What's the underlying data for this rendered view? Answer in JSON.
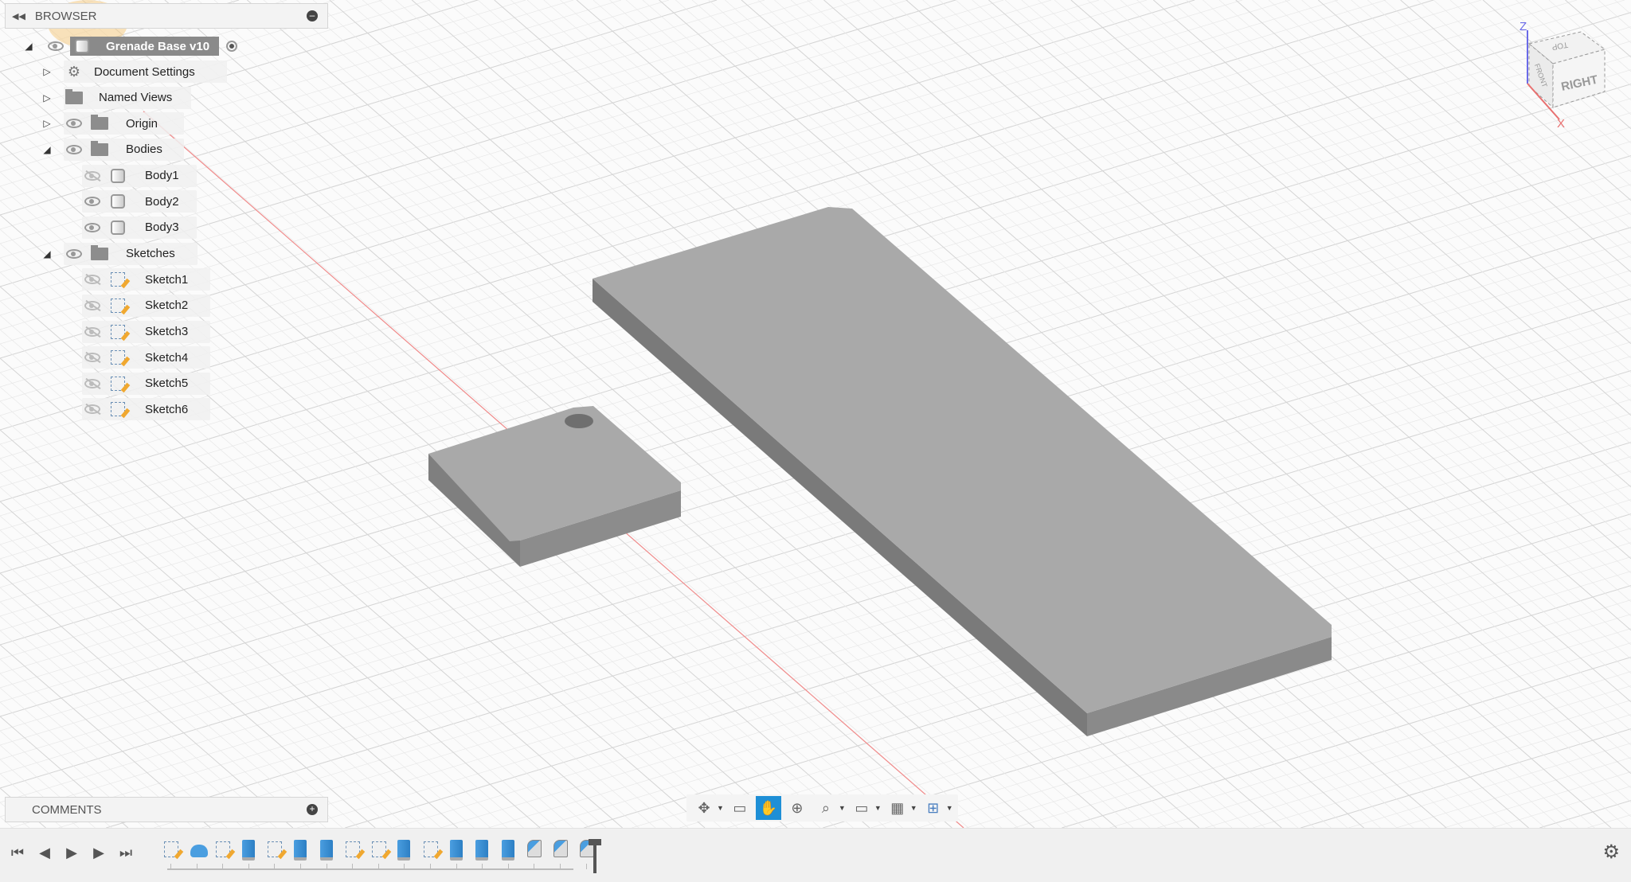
{
  "browser": {
    "title": "BROWSER",
    "root": {
      "label": "Grenade Base v10"
    },
    "items": [
      {
        "label": "Document Settings",
        "icon": "gear-icon",
        "toggle": "collapsed"
      },
      {
        "label": "Named Views",
        "icon": "folder-icon",
        "toggle": "collapsed"
      },
      {
        "label": "Origin",
        "icon": "folder-icon",
        "toggle": "collapsed",
        "visible": true
      },
      {
        "label": "Bodies",
        "icon": "folder-icon",
        "toggle": "expanded",
        "visible": true
      },
      {
        "label": "Body1",
        "icon": "body-icon",
        "visible": false
      },
      {
        "label": "Body2",
        "icon": "body-icon",
        "visible": true
      },
      {
        "label": "Body3",
        "icon": "body-icon",
        "visible": true
      },
      {
        "label": "Sketches",
        "icon": "folder-icon",
        "toggle": "expanded",
        "visible": true
      },
      {
        "label": "Sketch1",
        "icon": "sketch-icon",
        "visible": false
      },
      {
        "label": "Sketch2",
        "icon": "sketch-icon",
        "visible": false
      },
      {
        "label": "Sketch3",
        "icon": "sketch-icon",
        "visible": false
      },
      {
        "label": "Sketch4",
        "icon": "sketch-icon",
        "visible": false
      },
      {
        "label": "Sketch5",
        "icon": "sketch-icon",
        "visible": false
      },
      {
        "label": "Sketch6",
        "icon": "sketch-icon",
        "visible": false
      }
    ]
  },
  "comments": {
    "title": "COMMENTS"
  },
  "viewcube": {
    "face_right": "RIGHT",
    "face_top": "TOP",
    "face_front": "FRONT",
    "axis_z": "Z",
    "axis_x": "X"
  },
  "navbar": [
    "orbit-icon",
    "look-at-icon",
    "pan-icon",
    "zoom-icon",
    "fit-icon",
    "display-settings-icon",
    "grid-settings-icon",
    "viewports-icon"
  ],
  "timeline": {
    "features": [
      "sketch",
      "revolve",
      "sketch",
      "extrude",
      "sketch",
      "extrude",
      "extrude",
      "sketch",
      "sketch",
      "extrude",
      "sketch",
      "extrude",
      "extrude",
      "extrude",
      "fillet",
      "fillet",
      "fillet"
    ]
  },
  "colors": {
    "accent": "#1e8fd6",
    "model": "#a9a9a9",
    "axis_x": "#e05050",
    "axis_z": "#5060e0"
  }
}
